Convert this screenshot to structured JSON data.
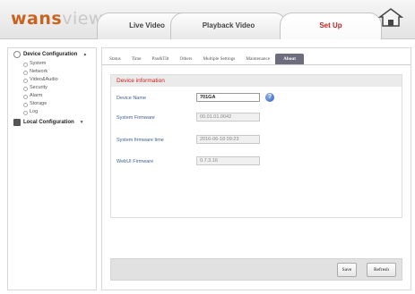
{
  "header": {
    "logo": {
      "first": "wans",
      "rest": "view"
    },
    "tabs": [
      {
        "label": "Live Video"
      },
      {
        "label": "Playback Video"
      },
      {
        "label": "Set Up",
        "active": true
      }
    ],
    "accent_color": "#c8211d"
  },
  "sidebar": {
    "device_config": "Device Configuration",
    "items": [
      "System",
      "Network",
      "Video&Audio",
      "Security",
      "Alarm",
      "Storage",
      "Log"
    ],
    "local_config": "Local Configuration"
  },
  "subtabs": [
    "Status",
    "Time",
    "Pan&Tilt",
    "Others",
    "Multiple Settings",
    "Maintenance",
    "About"
  ],
  "panel": {
    "title": "Device information",
    "rows": [
      {
        "label": "Device Name",
        "value": "701GA"
      },
      {
        "label": "System Firmware",
        "value": "00.01.01.0042"
      },
      {
        "label": "System firmware time",
        "value": "2016-06-18 09:23"
      },
      {
        "label": "WebUI Firmware",
        "value": "0.7.3.16"
      }
    ]
  },
  "buttons": {
    "save": "Save",
    "refresh": "Refresh"
  }
}
